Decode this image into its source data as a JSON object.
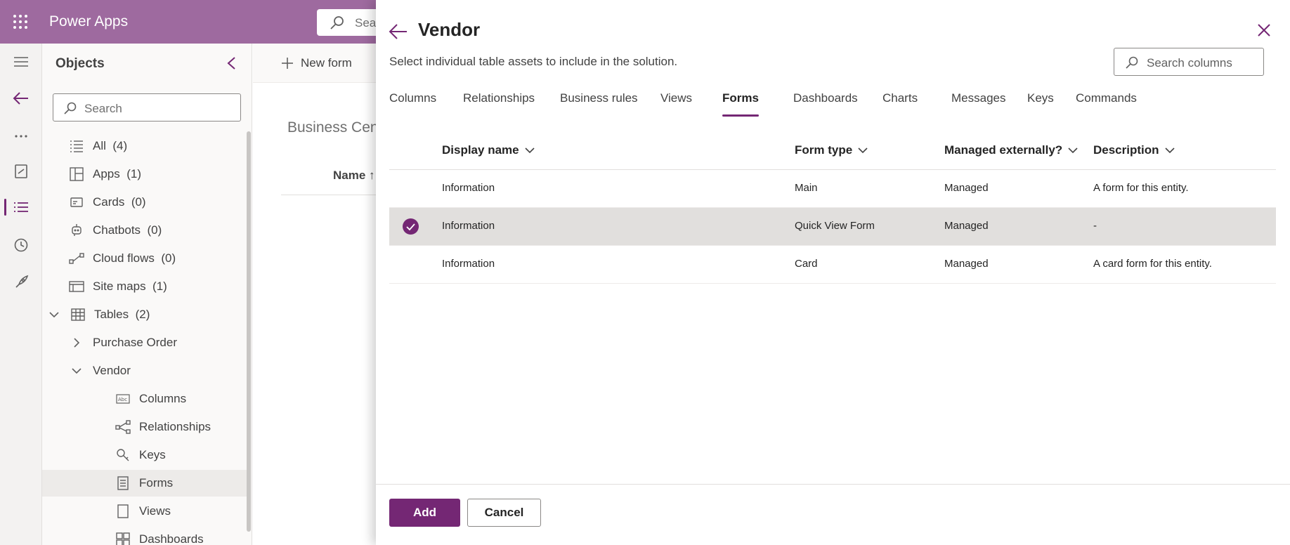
{
  "app": {
    "title": "Power Apps",
    "search_placeholder": "Sea"
  },
  "rail": {
    "items": [
      {
        "icon": "hamburger-icon"
      },
      {
        "icon": "back-arrow-icon"
      },
      {
        "icon": "more-icon",
        "label": "..."
      },
      {
        "icon": "book-icon"
      },
      {
        "icon": "list-icon",
        "active": true
      },
      {
        "icon": "history-icon"
      },
      {
        "icon": "rocket-icon"
      }
    ]
  },
  "objects": {
    "title": "Objects",
    "search_placeholder": "Search",
    "items": [
      {
        "label": "All",
        "count": "(4)",
        "icon": "list-icon"
      },
      {
        "label": "Apps",
        "count": "(1)",
        "icon": "apps-icon"
      },
      {
        "label": "Cards",
        "count": "(0)",
        "icon": "card-icon"
      },
      {
        "label": "Chatbots",
        "count": "(0)",
        "icon": "bot-icon"
      },
      {
        "label": "Cloud flows",
        "count": "(0)",
        "icon": "flow-icon"
      },
      {
        "label": "Site maps",
        "count": "(1)",
        "icon": "sitemap-icon"
      },
      {
        "label": "Tables",
        "count": "(2)",
        "icon": "table-icon",
        "expanded": true
      },
      {
        "label": "Purchase Order",
        "count": "",
        "icon": "chevron-right-icon"
      },
      {
        "label": "Vendor",
        "count": "",
        "icon": "chevron-down-icon",
        "expanded": true
      },
      {
        "label": "Columns",
        "count": "",
        "icon": "columns-icon"
      },
      {
        "label": "Relationships",
        "count": "",
        "icon": "relationships-icon"
      },
      {
        "label": "Keys",
        "count": "",
        "icon": "key-icon"
      },
      {
        "label": "Forms",
        "count": "",
        "icon": "form-icon",
        "selected": true
      },
      {
        "label": "Views",
        "count": "",
        "icon": "view-icon"
      },
      {
        "label": "Dashboards",
        "count": "",
        "icon": "dashboard-icon"
      }
    ]
  },
  "background": {
    "new_form_label": "New form",
    "heading": "Business Cen",
    "column_name": "Name ↑"
  },
  "panel": {
    "title": "Vendor",
    "subtitle": "Select individual table assets to include in the solution.",
    "search_placeholder": "Search columns",
    "tabs": [
      "Columns",
      "Relationships",
      "Business rules",
      "Views",
      "Forms",
      "Dashboards",
      "Charts",
      "Messages",
      "Keys",
      "Commands"
    ],
    "active_tab": "Forms",
    "columns": {
      "display_name": "Display name",
      "form_type": "Form type",
      "managed": "Managed externally?",
      "description": "Description"
    },
    "rows": [
      {
        "display_name": "Information",
        "form_type": "Main",
        "managed": "Managed",
        "description": "A form for this entity.",
        "selected": false
      },
      {
        "display_name": "Information",
        "form_type": "Quick View Form",
        "managed": "Managed",
        "description": "-",
        "selected": true
      },
      {
        "display_name": "Information",
        "form_type": "Card",
        "managed": "Managed",
        "description": "A card form for this entity.",
        "selected": false
      }
    ],
    "add_label": "Add",
    "cancel_label": "Cancel"
  },
  "colors": {
    "brand": "#742774",
    "topbar": "#9e6a9f"
  }
}
